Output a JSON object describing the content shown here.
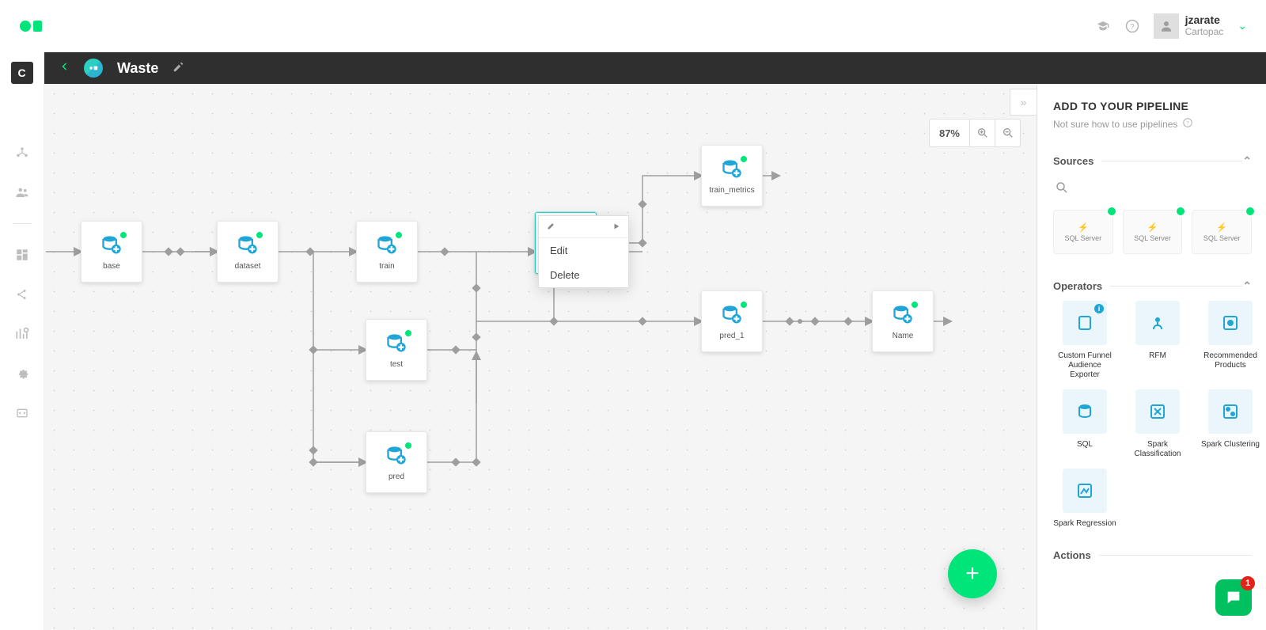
{
  "header": {
    "user_name": "jzarate",
    "user_org": "Cartopac"
  },
  "titlebar": {
    "title": "Waste"
  },
  "canvas": {
    "zoom": "87%",
    "workspace_initial": "C",
    "nodes": {
      "base": "base",
      "dataset": "dataset",
      "train": "train",
      "test": "test",
      "pred": "pred",
      "train_metrics": "train_metrics",
      "pred_1": "pred_1",
      "name": "Name"
    },
    "context_menu": {
      "edit": "Edit",
      "delete": "Delete"
    }
  },
  "panel": {
    "heading": "ADD TO YOUR PIPELINE",
    "subtext": "Not sure how to use pipelines",
    "sections": {
      "sources": "Sources",
      "operators": "Operators",
      "actions": "Actions"
    },
    "sources": [
      {
        "label": "SQL Server"
      },
      {
        "label": "SQL Server"
      },
      {
        "label": "SQL Server"
      }
    ],
    "operators": [
      {
        "label": "Custom Funnel Audience Exporter"
      },
      {
        "label": "RFM"
      },
      {
        "label": "Recommended Products"
      },
      {
        "label": "SQL"
      },
      {
        "label": "Spark Classification"
      },
      {
        "label": "Spark Clustering"
      },
      {
        "label": "Spark Regression"
      }
    ]
  },
  "chat": {
    "badge": "1"
  }
}
